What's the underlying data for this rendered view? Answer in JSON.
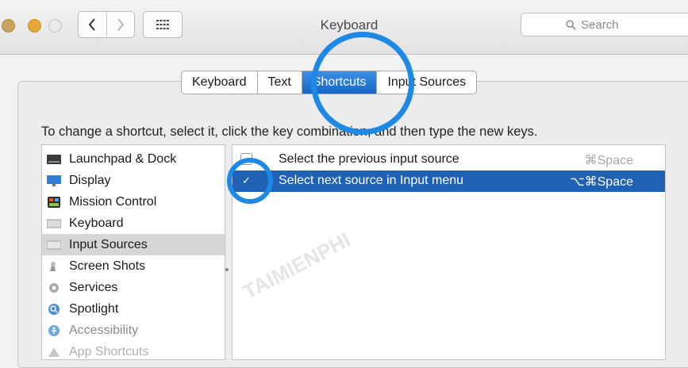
{
  "window": {
    "title": "Keyboard"
  },
  "search": {
    "placeholder": "Search"
  },
  "tabs": [
    {
      "label": "Keyboard",
      "active": false
    },
    {
      "label": "Text",
      "active": false
    },
    {
      "label": "Shortcuts",
      "active": true
    },
    {
      "label": "Input Sources",
      "active": false
    }
  ],
  "instruction": "To change a shortcut, select it, click the key combination, and then type the new keys.",
  "categories": [
    {
      "label": "Launchpad & Dock",
      "icon": "launchpad-dock-icon",
      "selected": false
    },
    {
      "label": "Display",
      "icon": "display-icon",
      "selected": false
    },
    {
      "label": "Mission Control",
      "icon": "mission-control-icon",
      "selected": false
    },
    {
      "label": "Keyboard",
      "icon": "keyboard-icon",
      "selected": false
    },
    {
      "label": "Input Sources",
      "icon": "input-sources-icon",
      "selected": true
    },
    {
      "label": "Screen Shots",
      "icon": "screen-shots-icon",
      "selected": false
    },
    {
      "label": "Services",
      "icon": "services-gear-icon",
      "selected": false
    },
    {
      "label": "Spotlight",
      "icon": "spotlight-icon",
      "selected": false
    },
    {
      "label": "Accessibility",
      "icon": "accessibility-icon",
      "selected": false
    },
    {
      "label": "App Shortcuts",
      "icon": "app-shortcuts-icon",
      "selected": false
    }
  ],
  "shortcuts": [
    {
      "label": "Select the previous input source",
      "key": "⌘Space",
      "checked": false,
      "selected": false
    },
    {
      "label": "Select next source in Input menu",
      "key": "⌥⌘Space",
      "checked": true,
      "selected": true
    }
  ],
  "checkmark": "✓",
  "colors": {
    "accent": "#1f62b5",
    "highlight_ring": "#1e88e5"
  },
  "watermark": "TAIMIENPHI"
}
